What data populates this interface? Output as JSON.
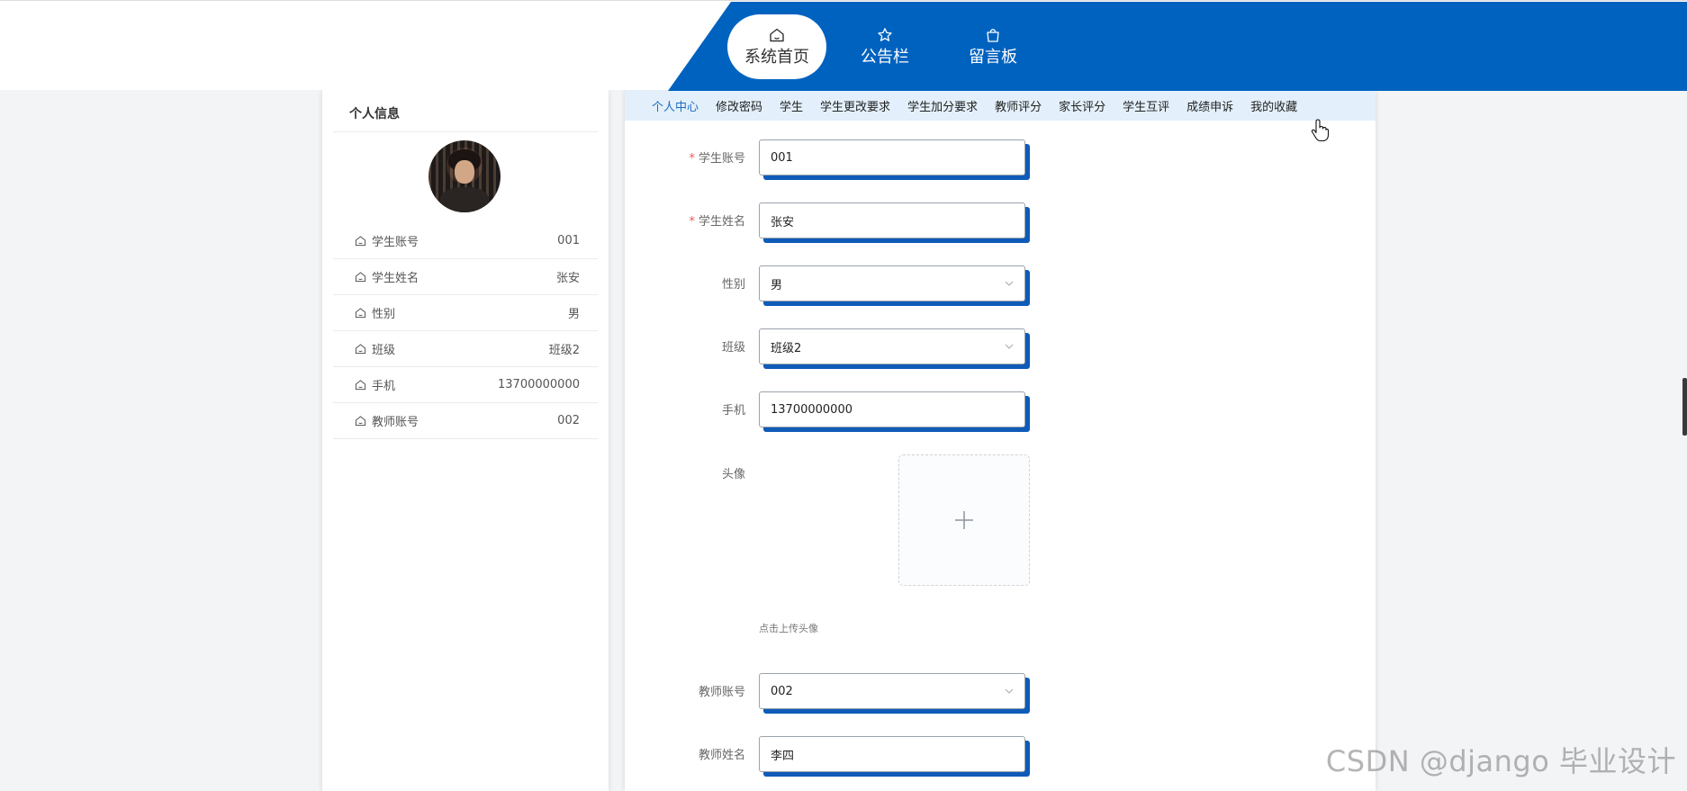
{
  "topnav": {
    "items": [
      {
        "label": "系统首页",
        "icon": "home-icon"
      },
      {
        "label": "公告栏",
        "icon": "star-icon"
      },
      {
        "label": "留言板",
        "icon": "bag-icon"
      }
    ]
  },
  "profile": {
    "title": "个人信息",
    "rows": [
      {
        "label": "学生账号",
        "value": "001"
      },
      {
        "label": "学生姓名",
        "value": "张安"
      },
      {
        "label": "性别",
        "value": "男"
      },
      {
        "label": "班级",
        "value": "班级2"
      },
      {
        "label": "手机",
        "value": "13700000000"
      },
      {
        "label": "教师账号",
        "value": "002"
      }
    ]
  },
  "subnav": {
    "items": [
      "个人中心",
      "修改密码",
      "学生",
      "学生更改要求",
      "学生加分要求",
      "教师评分",
      "家长评分",
      "学生互评",
      "成绩申诉",
      "我的收藏"
    ]
  },
  "form": {
    "student_account": {
      "label": "学生账号",
      "value": "001",
      "required": "*"
    },
    "student_name": {
      "label": "学生姓名",
      "value": "张安",
      "required": "*"
    },
    "gender": {
      "label": "性别",
      "value": "男"
    },
    "class": {
      "label": "班级",
      "value": "班级2"
    },
    "phone": {
      "label": "手机",
      "value": "13700000000"
    },
    "avatar": {
      "label": "头像",
      "hint": "点击上传头像"
    },
    "teacher_account": {
      "label": "教师账号",
      "value": "002"
    },
    "teacher_name": {
      "label": "教师姓名",
      "value": "李四"
    }
  },
  "watermark": "CSDN @django 毕业设计",
  "colors": {
    "brand": "#0062bf",
    "subnav_bg": "#e3f0fb",
    "active_link": "#1e6bbf"
  }
}
